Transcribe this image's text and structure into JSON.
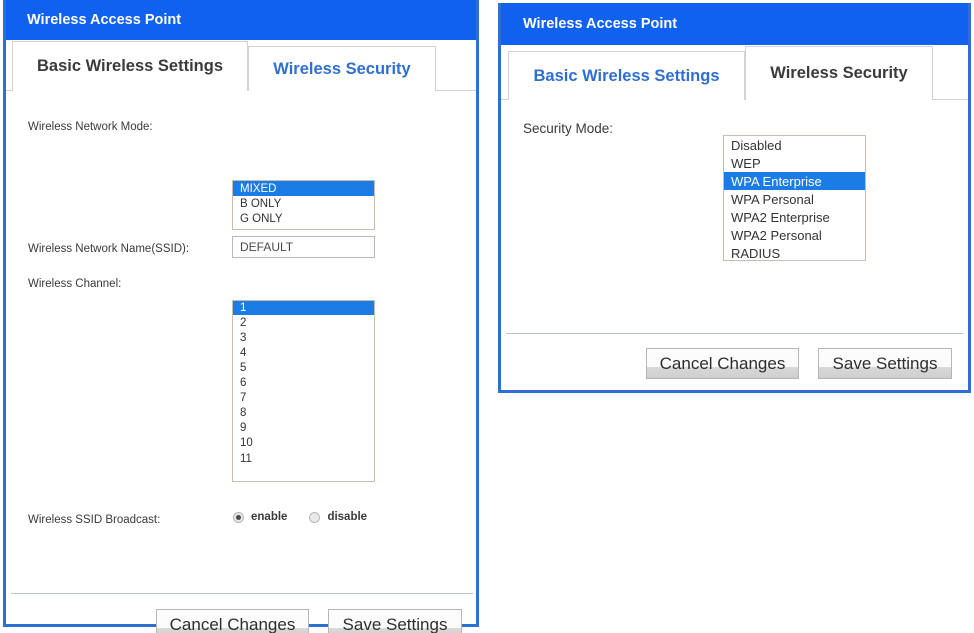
{
  "left_panel": {
    "title": "Wireless Access Point",
    "tabs": [
      {
        "label": "Basic Wireless Settings",
        "active": true
      },
      {
        "label": "Wireless Security",
        "active": false
      }
    ],
    "fields": {
      "network_mode": {
        "label": "Wireless Network Mode:",
        "value": "MIXED",
        "options": [
          "MIXED",
          "B ONLY",
          "G ONLY"
        ],
        "selected": "MIXED",
        "expanded": true
      },
      "ssid": {
        "label": "Wireless Network Name(SSID):",
        "value": "DEFAULT",
        "placeholder": ""
      },
      "channel": {
        "label": "Wireless Channel:",
        "value": "1",
        "options": [
          "1",
          "2",
          "3",
          "4",
          "5",
          "6",
          "7",
          "8",
          "9",
          "10",
          "11"
        ],
        "selected": "1",
        "expanded": true
      },
      "ssid_broadcast": {
        "label": "Wireless SSID Broadcast:",
        "options": [
          {
            "label": "enable",
            "checked": true
          },
          {
            "label": "disable",
            "checked": false
          }
        ]
      }
    },
    "buttons": {
      "cancel": "Cancel Changes",
      "save": "Save Settings"
    }
  },
  "right_panel": {
    "title": "Wireless Access Point",
    "tabs": [
      {
        "label": "Basic Wireless Settings",
        "active": false
      },
      {
        "label": "Wireless Security",
        "active": true
      }
    ],
    "fields": {
      "security_mode": {
        "label": "Security Mode:",
        "value": "Disabled",
        "options": [
          "Disabled",
          "WEP",
          "WPA Enterprise",
          "WPA Personal",
          "WPA2 Enterprise",
          "WPA2 Personal",
          "RADIUS"
        ],
        "selected": "WPA Enterprise",
        "expanded": true
      }
    },
    "buttons": {
      "cancel": "Cancel Changes",
      "save": "Save Settings"
    }
  },
  "colors": {
    "header_blue": "#1061f0",
    "panel_border": "#2f6fd0",
    "tab_link": "#2f6fd0",
    "highlight_blue": "#1b7ce6",
    "select_lavender": "#d2d2f2"
  }
}
